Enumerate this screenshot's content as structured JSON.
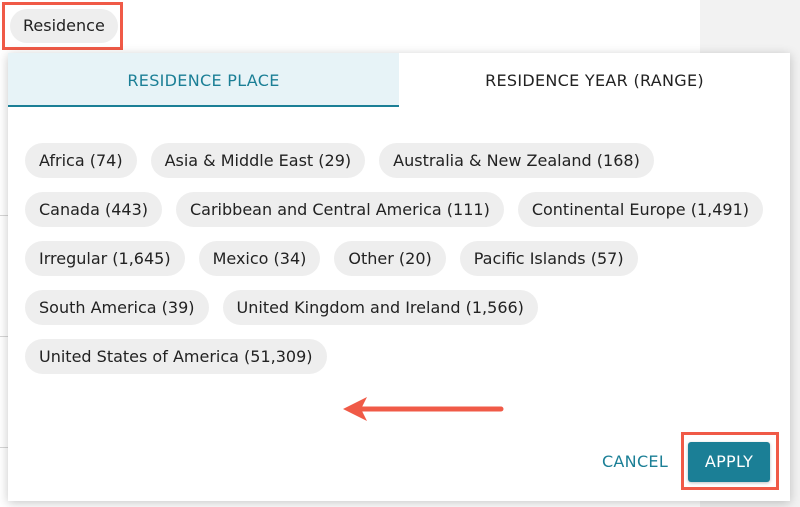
{
  "trigger": {
    "label": "Residence"
  },
  "tabs": [
    {
      "label": "RESIDENCE PLACE",
      "active": true
    },
    {
      "label": "RESIDENCE YEAR (RANGE)",
      "active": false
    }
  ],
  "chips": {
    "row1": [
      "Africa (74)",
      "Asia & Middle East (29)",
      "Australia & New Zealand (168)"
    ],
    "row2": [
      "Canada (443)",
      "Caribbean and Central America (111)",
      "Continental Europe (1,491)"
    ],
    "row3": [
      "Irregular (1,645)",
      "Mexico (34)",
      "Other (20)",
      "Pacific Islands (57)"
    ],
    "row4": [
      "South America (39)",
      "United Kingdom and Ireland (1,566)"
    ],
    "row5": [
      "United States of America (51,309)"
    ]
  },
  "actions": {
    "cancel_label": "CANCEL",
    "apply_label": "APPLY"
  },
  "colors": {
    "accent": "#1b7f96",
    "highlight": "#f05a47",
    "chip_bg": "#eeeeee",
    "active_tab_bg": "#e7f3f7"
  }
}
